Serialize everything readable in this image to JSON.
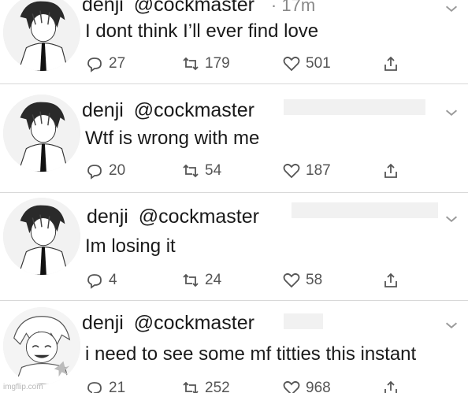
{
  "colors": {
    "background": "#ffffff",
    "text": "#1a1a1a",
    "muted": "#555555",
    "divider": "#d8d8d8"
  },
  "tweets": [
    {
      "display_name": "denji",
      "handle": "@cockmaster",
      "time": "· 17m",
      "text": "I dont think I’ll ever find love",
      "replies": "27",
      "retweets": "179",
      "likes": "501",
      "avatar_icon": "chainsaw-man-manga-avatar-icon"
    },
    {
      "display_name": "denji",
      "handle": "@cockmaster",
      "text": "Wtf is wrong with me",
      "replies": "20",
      "retweets": "54",
      "likes": "187",
      "avatar_icon": "chainsaw-man-manga-avatar-icon"
    },
    {
      "display_name": "denji",
      "handle": "@cockmaster",
      "text": "Im losing it",
      "replies": "4",
      "retweets": "24",
      "likes": "58",
      "avatar_icon": "chainsaw-man-manga-avatar-icon"
    },
    {
      "display_name": "denji",
      "handle": "@cockmaster",
      "text": "i need to see some mf titties this instant",
      "replies": "21",
      "retweets": "252",
      "likes": "968",
      "avatar_icon": "chainsaw-man-happy-avatar-icon"
    }
  ],
  "icons": {
    "reply": "reply-icon",
    "retweet": "retweet-icon",
    "like": "heart-icon",
    "share": "share-icon",
    "menu": "chevron-down-icon"
  },
  "watermark": "imgflip.com"
}
